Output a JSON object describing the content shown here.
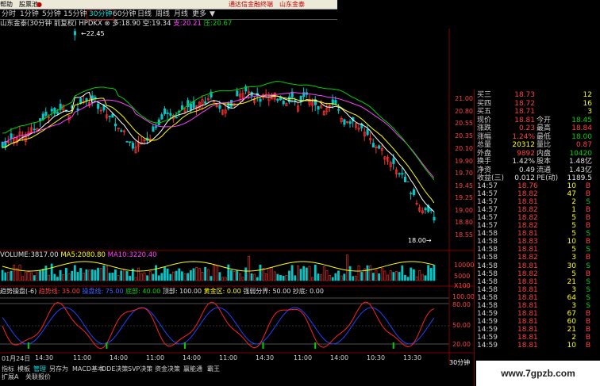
{
  "menubar": {
    "item1": "帮助",
    "item2": "股票池",
    "ad1": "通达信金融终端",
    "ad2": "山东金泰"
  },
  "tabs": [
    "分时",
    "1分钟",
    "5分钟",
    "15分钟",
    "30分钟",
    "60分钟",
    "日线",
    "周线",
    "月线",
    "更多"
  ],
  "active_tab": "30分钟",
  "header": {
    "stock": "山东金泰(30分钟 前复权)",
    "indicator": "HPDKX",
    "duo_label": "多:",
    "duo_value": "18.90",
    "kong_label": "空:",
    "kong_value": "19.34",
    "zhi_label": "支:",
    "zhi_value": "20.21",
    "ya_label": "压:",
    "ya_value": "20.67"
  },
  "price_axis": [
    "21.00",
    "20.80",
    "20.55",
    "20.35",
    "20.10",
    "19.90",
    "19.70",
    "19.45",
    "19.25",
    "19.00",
    "18.80",
    "18.55",
    "18.35"
  ],
  "price_marks": {
    "high": "22.45",
    "low": "18.00"
  },
  "volume_header": {
    "vol_label": "VOLUME:",
    "vol_value": "3817.00",
    "ma5_label": "MA5:",
    "ma5_value": "2080.80",
    "ma10_label": "MA10:",
    "ma10_value": "3220.40"
  },
  "volume_axis": [
    "10000",
    "5000",
    "X100"
  ],
  "osc_header": {
    "name": "趋势操盘(-6)",
    "l1": "趋势线: 35.00",
    "l2": "操盘线: 75.00",
    "l3": "底部: 40.00",
    "l4": "顶部: 100.00",
    "l5": "黄金区: 0.00",
    "l6": "强弱分界: 50.00",
    "l7": "抄底: 0.00"
  },
  "osc_axis": [
    "100.00",
    "80.00",
    "50.00",
    "20.00"
  ],
  "time_axis": [
    "01月24日",
    "14:30",
    "11:00",
    "14:00",
    "11:00",
    "14:00",
    "11:00",
    "14:30",
    "11:00",
    "14:00",
    "10:30",
    "13:30"
  ],
  "bottom_tabs": [
    "指标",
    "模板",
    "管理",
    "另存为",
    "MACD基本",
    "DDE决策",
    "SVP决策",
    "资金决策",
    "赢能通",
    "霸王"
  ],
  "bottom_row2": [
    "扩展A",
    "关联报价"
  ],
  "bottom_period": "30分钟",
  "quote": {
    "rows": [
      {
        "l": "买三",
        "v": "18.73",
        "vc": "r",
        "l2": "",
        "v2": "12",
        "v2c": "y"
      },
      {
        "l": "买四",
        "v": "18.72",
        "vc": "r",
        "l2": "",
        "v2": "16",
        "v2c": "y"
      },
      {
        "l": "买五",
        "v": "18.71",
        "vc": "r",
        "l2": "",
        "v2": "3",
        "v2c": "y"
      },
      {
        "l": "现价",
        "v": "18.81",
        "vc": "r",
        "l2": "今开",
        "v2": "18.45",
        "v2c": "g"
      },
      {
        "l": "涨跌",
        "v": "0.23",
        "vc": "r",
        "l2": "最高",
        "v2": "18.84",
        "v2c": "r"
      },
      {
        "l": "涨幅",
        "v": "1.24%",
        "vc": "r",
        "l2": "最低",
        "v2": "18.00",
        "v2c": "g"
      },
      {
        "l": "总量",
        "v": "20312",
        "vc": "y",
        "l2": "量比",
        "v2": "0.87",
        "v2c": "r"
      },
      {
        "l": "外盘",
        "v": "9892",
        "vc": "r",
        "l2": "内盘",
        "v2": "10420",
        "v2c": "g"
      },
      {
        "l": "换手",
        "v": "1.42%",
        "vc": "w",
        "l2": "股本",
        "v2": "1.48亿",
        "v2c": "w"
      },
      {
        "l": "净资",
        "v": "0.49",
        "vc": "w",
        "l2": "流通",
        "v2": "1.43亿",
        "v2c": "w"
      },
      {
        "l": "收益(三)",
        "v": "0.012",
        "vc": "w",
        "l2": "PE(动)",
        "v2": "1189.5",
        "v2c": "w"
      }
    ]
  },
  "ticks": [
    {
      "t": "14:57",
      "p": "18.76",
      "v": "10",
      "bs": "B"
    },
    {
      "t": "14:57",
      "p": "18.82",
      "v": "47",
      "bs": "B"
    },
    {
      "t": "14:57",
      "p": "18.81",
      "v": "2",
      "bs": "S"
    },
    {
      "t": "14:57",
      "p": "18.82",
      "v": "1",
      "bs": "B"
    },
    {
      "t": "14:57",
      "p": "18.82",
      "v": "5",
      "bs": "B"
    },
    {
      "t": "14:57",
      "p": "18.82",
      "v": "5",
      "bs": "B"
    },
    {
      "t": "14:58",
      "p": "18.81",
      "v": "5",
      "bs": "S"
    },
    {
      "t": "14:58",
      "p": "18.83",
      "v": "10",
      "bs": "B"
    },
    {
      "t": "14:58",
      "p": "18.81",
      "v": "5",
      "bs": "S"
    },
    {
      "t": "14:58",
      "p": "18.82",
      "v": "3",
      "bs": "B"
    },
    {
      "t": "14:58",
      "p": "18.81",
      "v": "30",
      "bs": "S"
    },
    {
      "t": "14:58",
      "p": "18.82",
      "v": "5",
      "bs": "B"
    },
    {
      "t": "14:58",
      "p": "18.81",
      "v": "21",
      "bs": "S"
    },
    {
      "t": "14:58",
      "p": "18.81",
      "v": "3",
      "bs": "S"
    },
    {
      "t": "14:58",
      "p": "18.81",
      "v": "64",
      "bs": "S"
    },
    {
      "t": "14:58",
      "p": "18.81",
      "v": "3",
      "bs": "S"
    },
    {
      "t": "14:59",
      "p": "18.81",
      "v": "67",
      "bs": "B"
    },
    {
      "t": "14:59",
      "p": "18.81",
      "v": "60",
      "bs": "B"
    },
    {
      "t": "14:59",
      "p": "18.81",
      "v": "21",
      "bs": "B"
    },
    {
      "t": "14:59",
      "p": "18.81",
      "v": "2",
      "bs": "B"
    },
    {
      "t": "14:59",
      "p": "18.81",
      "v": "10",
      "bs": "B"
    }
  ],
  "watermark": "www.7gpzb.com"
}
